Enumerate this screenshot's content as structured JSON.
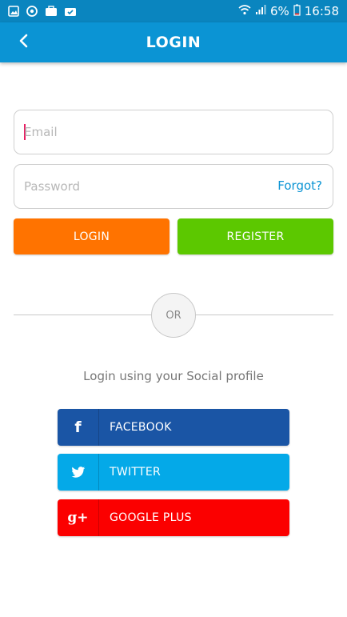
{
  "status_bar": {
    "battery_percent": "6%",
    "time": "16:58"
  },
  "app_bar": {
    "title": "LOGIN"
  },
  "form": {
    "email_placeholder": "Email",
    "password_placeholder": "Password",
    "forgot_label": "Forgot?",
    "login_label": "LOGIN",
    "register_label": "REGISTER",
    "or_label": "OR"
  },
  "social": {
    "caption": "Login using your Social profile",
    "buttons": [
      {
        "label": "FACEBOOK",
        "icon": "facebook-icon",
        "glyph": "f",
        "color": "#1a55a5"
      },
      {
        "label": "TWITTER",
        "icon": "twitter-icon",
        "glyph": "",
        "color": "#04a9e8"
      },
      {
        "label": "GOOGLE PLUS",
        "icon": "google-plus-icon",
        "glyph": "g+",
        "color": "#fb0000"
      }
    ]
  },
  "colors": {
    "status_bar": "#0a85bf",
    "app_bar": "#0b94d4",
    "login_button": "#ff7300",
    "register_button": "#5cc800",
    "link": "#0b94d4"
  }
}
